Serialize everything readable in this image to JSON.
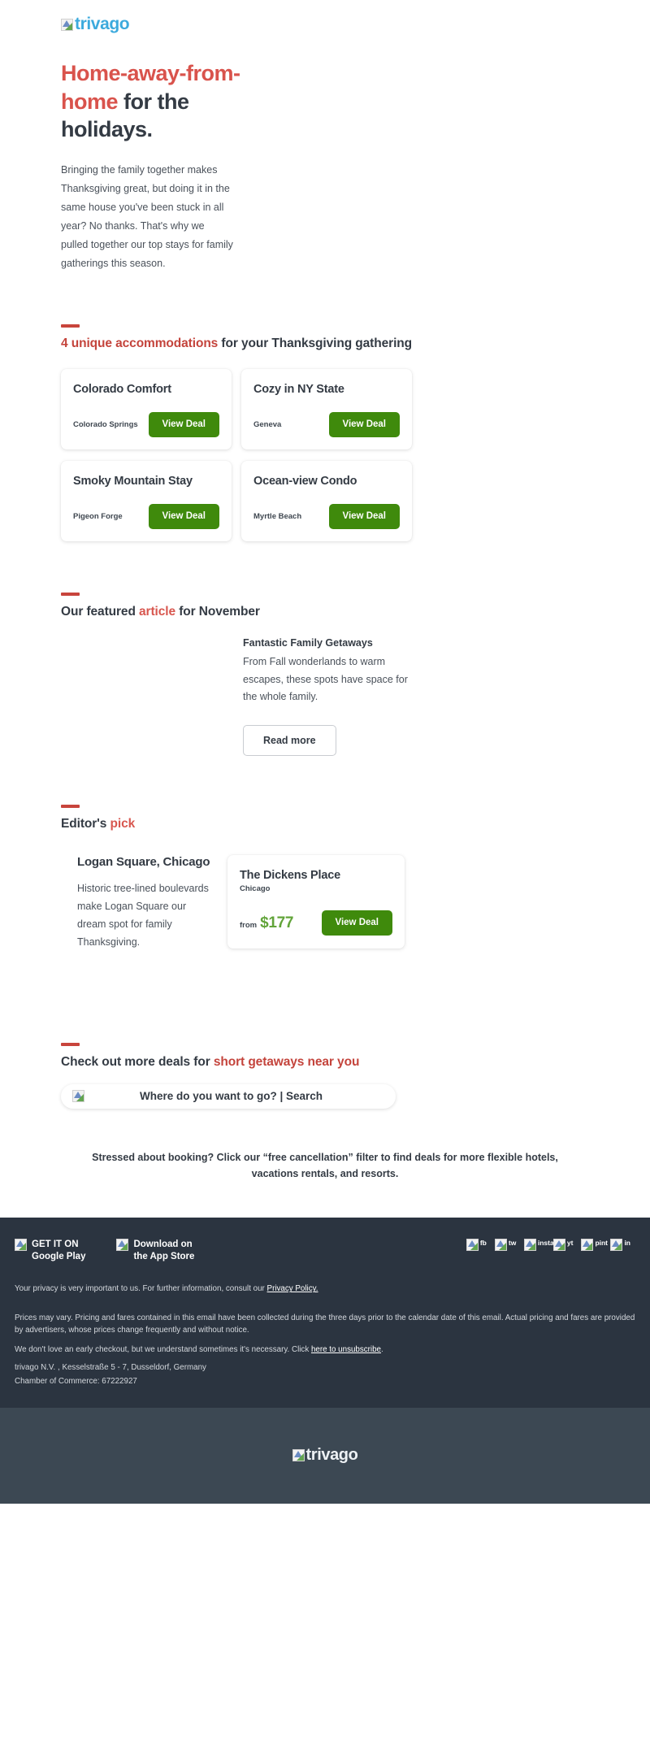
{
  "brand": {
    "logo_alt": "trivago",
    "logo_color": "#3caadd",
    "accent_red": "#c8443c",
    "accent_red_light": "#d8574f",
    "green": "#3f8a0c",
    "price_green": "#62a43a",
    "footer_dark": "#2b3440",
    "footer_bottom": "#3c4853"
  },
  "hero": {
    "title_red": "Home-away-from-home",
    "title_rest": " for the holidays.",
    "body": "Bringing the family together makes Thanksgiving great, but doing it in the same house you've been stuck in all year? No thanks. That's why we pulled together our top stays for family gatherings this season."
  },
  "accommodations": {
    "heading_highlight": "4 unique accommodations",
    "heading_rest": " for your Thanksgiving gathering",
    "cta_label": "View Deal",
    "cards": [
      {
        "title": "Colorado Comfort",
        "location": "Colorado Springs",
        "cta": "View Deal"
      },
      {
        "title": "Cozy in NY State",
        "location": "Geneva",
        "cta": "View Deal"
      },
      {
        "title": "Smoky Mountain Stay",
        "location": "Pigeon Forge",
        "cta": "View Deal"
      },
      {
        "title": "Ocean-view Condo",
        "location": "Myrtle Beach",
        "cta": "View Deal"
      }
    ]
  },
  "article": {
    "heading_pre": "Our featured ",
    "heading_highlight": "article",
    "heading_post": " for November",
    "title": "Fantastic Family Getaways",
    "body": "From Fall wonderlands to warm escapes, these spots have space for the whole family.",
    "cta": "Read more"
  },
  "editor": {
    "heading_pre": "Editor's ",
    "heading_highlight": "pick",
    "place_title": "Logan Square, Chicago",
    "place_body": "Historic tree-lined boulevards make Logan Square our dream spot for family Thanksgiving.",
    "card": {
      "title": "The Dickens Place",
      "city": "Chicago",
      "price_prefix": "from",
      "price": "$177",
      "cta": "View Deal"
    }
  },
  "search": {
    "heading_pre": "Check out more deals for ",
    "heading_highlight": "short getaways near you",
    "bar_label": "Where do you want to go? | Search",
    "bar_icon_alt": ""
  },
  "note": {
    "text": "Stressed about booking? Click our “free cancellation” filter to find deals for more flexible hotels, vacations rentals, and resorts."
  },
  "footer": {
    "google_play": {
      "line1": "GET IT ON",
      "line2": "Google Play",
      "alt": ""
    },
    "app_store": {
      "line1": "Download on",
      "line2": "the App Store",
      "alt": ""
    },
    "social": [
      {
        "name": "facebook",
        "label": "fb"
      },
      {
        "name": "twitter",
        "label": "tw"
      },
      {
        "name": "instagram",
        "label": "insta"
      },
      {
        "name": "youtube",
        "label": "yt"
      },
      {
        "name": "pinterest",
        "label": "pint"
      },
      {
        "name": "linkedin",
        "label": "in"
      }
    ],
    "privacy_pre": "Your privacy is very important to us. For further information, consult our ",
    "privacy_link": "Privacy Policy.",
    "legal_1": "Prices may vary. Pricing and fares contained in this email have been collected during the three days prior to the calendar date of this email. Actual pricing and fares are provided by advertisers, whose prices change frequently and without notice.",
    "legal_2_pre": "We don't love an early checkout, but we understand sometimes it's necessary. Click ",
    "legal_2_link": "here to unsubscribe",
    "legal_2_post": ".",
    "address": "trivago N.V. , Kesselstraße 5 - 7, Dusseldorf, Germany",
    "chamber": "Chamber of Commerce: 67222927",
    "bottom_logo_alt": "trivago"
  }
}
